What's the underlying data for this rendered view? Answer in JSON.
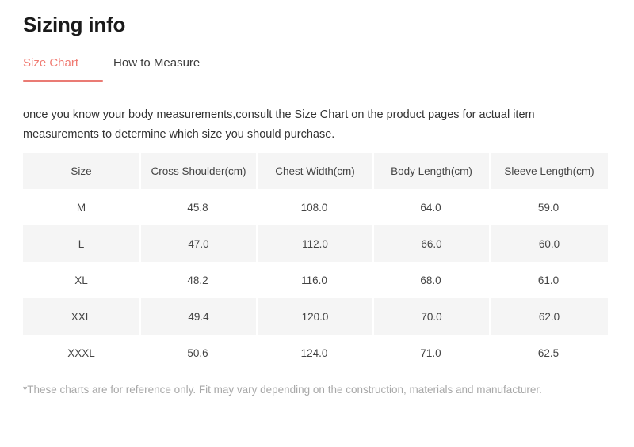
{
  "header": {
    "title": "Sizing info"
  },
  "tabs": {
    "active_index": 0,
    "accent_color": "#ea7b74",
    "items": [
      {
        "label": "Size Chart"
      },
      {
        "label": "How to Measure"
      }
    ]
  },
  "intro": {
    "text": "once you know your body measurements,consult the Size Chart on the product pages for actual item measurements to determine which size you should purchase."
  },
  "table": {
    "headers": [
      "Size",
      "Cross Shoulder(cm)",
      "Chest Width(cm)",
      "Body Length(cm)",
      "Sleeve Length(cm)"
    ],
    "rows": [
      {
        "cells": [
          "M",
          "45.8",
          "108.0",
          "64.0",
          "59.0"
        ]
      },
      {
        "cells": [
          "L",
          "47.0",
          "112.0",
          "66.0",
          "60.0"
        ]
      },
      {
        "cells": [
          "XL",
          "48.2",
          "116.0",
          "68.0",
          "61.0"
        ]
      },
      {
        "cells": [
          "XXL",
          "49.4",
          "120.0",
          "70.0",
          "62.0"
        ]
      },
      {
        "cells": [
          "XXXL",
          "50.6",
          "124.0",
          "71.0",
          "62.5"
        ]
      }
    ],
    "shaded_row_color": "#f5f5f5",
    "plain_row_color": "#ffffff"
  },
  "footnote": {
    "text": "*These charts are for reference only. Fit may vary depending on the construction, materials and manufacturer."
  }
}
